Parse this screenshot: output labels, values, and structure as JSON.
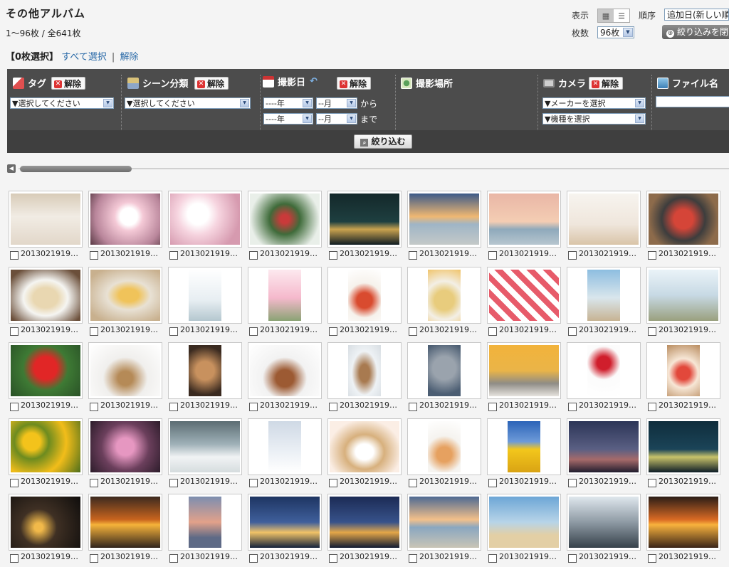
{
  "header": {
    "title": "その他アルバム",
    "count_text": "1〜96枚 / 全641枚",
    "selection_count": "【0枚選択】",
    "select_all": "すべて選択",
    "separator": "|",
    "deselect": "解除"
  },
  "controls": {
    "display_label": "表示",
    "view_grid_icon": "grid-view-icon",
    "view_list_icon": "list-view-icon",
    "order_label": "順序",
    "order_value": "追加日(新しい順",
    "count_label": "枚数",
    "count_value": "96枚",
    "narrow_button": "絞り込みを閉"
  },
  "filters": {
    "tag": {
      "label": "タグ",
      "clear": "解除",
      "select": "▼選択してください",
      "icon": "tag-icon",
      "color": "#e05050"
    },
    "scene": {
      "label": "シーン分類",
      "clear": "解除",
      "select": "▼選択してください",
      "icon": "scene-icon",
      "color": "#d9c27a"
    },
    "date": {
      "label": "撮影日",
      "clear": "解除",
      "icon": "calendar-icon",
      "reset_icon": "undo-icon",
      "year1": "----年",
      "month1": "--月",
      "from": "から",
      "year2": "----年",
      "month2": "--月",
      "to": "まで"
    },
    "place": {
      "label": "撮影場所",
      "icon": "map-icon"
    },
    "camera": {
      "label": "カメラ",
      "clear": "解除",
      "icon": "camera-icon",
      "maker": "▼メーカーを選択",
      "model": "▼機種を選択"
    },
    "filename": {
      "label": "ファイル名",
      "icon": "file-icon",
      "value": ""
    },
    "apply": "絞り込む"
  },
  "photo_label": "2013021919…",
  "photos": [
    [
      {
        "desc": "woman-cafe",
        "bg": "linear-gradient(#d8cbb8,#f1ece4 45%,#e2d7c9)",
        "p": false
      },
      {
        "desc": "cherry-blossom",
        "bg": "radial-gradient(circle at 55% 45%,#ffffff 0 18%,#f4c9d6 30%,#b9869b 70%,#5a3a45)",
        "p": false
      },
      {
        "desc": "cherry-blossom",
        "bg": "radial-gradient(circle at 40% 40%,#fff 0 20%,#f6d4df 40%,#d69aaf 80%)",
        "p": false
      },
      {
        "desc": "red-berries",
        "bg": "radial-gradient(circle at 50% 50%,#c93a3a 0 10%,#3f6b3a 35%,#e9efe9 80%)",
        "p": false
      },
      {
        "desc": "night-city",
        "bg": "linear-gradient(#14282a,#1e3f40 55%,#c9a24f 70%,#0f1c22)",
        "p": false
      },
      {
        "desc": "beach-sunset",
        "bg": "linear-gradient(#3c5a88,#f0b872 45%,#9fb5c6 60%,#c4c9c8)",
        "p": false
      },
      {
        "desc": "beach-dusk",
        "bg": "linear-gradient(#e9b6a6,#f4cdb3 55%,#8fa9bb 70%,#b7c6cf)",
        "p": false
      },
      {
        "desc": "woman-dog",
        "bg": "linear-gradient(#f7f4ef,#efe6dc 60%,#d9c4a8)",
        "p": false
      },
      {
        "desc": "sashimi",
        "bg": "radial-gradient(circle at 50% 50%,#d54538 0 22%,#3d3d3d 50%,#8d6b4b 80%)",
        "p": false
      }
    ],
    [
      {
        "desc": "food-plate",
        "bg": "radial-gradient(ellipse at 50% 55%,#e9d7b1 0 25%,#f5f5f2 45%,#6b4f3a 85%)",
        "p": false
      },
      {
        "desc": "tempura",
        "bg": "radial-gradient(ellipse at 55% 50%,#f0c35a 0 18%,#e8e1d4 40%,#c8b08e 85%)",
        "p": false
      },
      {
        "desc": "woman-camera",
        "bg": "linear-gradient(#ffffff,#e7eef2 60%,#b4c7cf)",
        "p": true
      },
      {
        "desc": "tulips",
        "bg": "linear-gradient(#fde9ef,#f5b9cc 55%,#8aa374)",
        "p": true
      },
      {
        "desc": "pasta",
        "bg": "radial-gradient(circle at 50% 60%,#d94b2f 0 22%,#f6f2ec 50%,#ffffff)",
        "p": true
      },
      {
        "desc": "spaghetti",
        "bg": "radial-gradient(circle at 50% 60%,#e8cc7d 0 28%,#f3efe6 55%,#f0c46a)",
        "p": true
      },
      {
        "desc": "salad-tray",
        "bg": "repeating-linear-gradient(45deg,#ffffff 0 8px,#e75b6a 8px 16px)",
        "p": false
      },
      {
        "desc": "beach-couple",
        "bg": "linear-gradient(#8dbde0,#d9e6ec 55%,#c7b393)",
        "p": true
      },
      {
        "desc": "elderly-couple",
        "bg": "linear-gradient(#eaf3f8,#c7d9e4 50%,#9aa07e)",
        "p": false
      }
    ],
    [
      {
        "desc": "hibiscus",
        "bg": "radial-gradient(circle at 50% 45%,#e12626 0 25%,#3e7a34 50%,#2a5227)",
        "p": false
      },
      {
        "desc": "dachshund",
        "bg": "radial-gradient(ellipse at 50% 65%,#b58a57 0 15%,#f0efed 45%,#ffffff)",
        "p": false
      },
      {
        "desc": "chihuahua",
        "bg": "radial-gradient(circle at 50% 50%,#c8915e 0 30%,#3a2a20 80%)",
        "p": true
      },
      {
        "desc": "poodle",
        "bg": "radial-gradient(ellipse at 50% 65%,#9c5a33 0 18%,#f2f2f2 45%,#ffffff)",
        "p": false
      },
      {
        "desc": "puppy",
        "bg": "radial-gradient(ellipse at 50% 55%,#a87a50 0 22%,#eef2f5 55%,#d7dde2)",
        "p": true
      },
      {
        "desc": "kitten",
        "bg": "radial-gradient(circle at 50% 45%,#9aa3ad 0 35%,#4c5e73 80%)",
        "p": true
      },
      {
        "desc": "cat-yellow",
        "bg": "linear-gradient(#f2b33b,#eab448 50%,#8f8c86 75%,#e6e3de)",
        "p": false
      },
      {
        "desc": "carnations",
        "bg": "radial-gradient(circle at 50% 35%,#d01e2c 0 18%,#fbfbfb 45%,#ffffff)",
        "p": true
      },
      {
        "desc": "cake",
        "bg": "radial-gradient(circle at 50% 55%,#e2483b 0 20%,#f7e7d6 45%,#b88b5e)",
        "p": true
      }
    ],
    [
      {
        "desc": "sunflowers",
        "bg": "radial-gradient(circle at 30% 40%,#f3c31b 0 15%,#6d8b1f 30%,#f2bd1a 60%,#4d6e1b)",
        "p": false
      },
      {
        "desc": "plum-blossom",
        "bg": "radial-gradient(circle at 50% 50%,#e697c1 0 20%,#6b3f5c 55%,#2c1c2a)",
        "p": false
      },
      {
        "desc": "snow-village",
        "bg": "linear-gradient(#5c6d73,#9fb1b8 45%,#f1f3f4 70%,#d5dcde)",
        "p": false
      },
      {
        "desc": "snow-cabin",
        "bg": "linear-gradient(#cfd9e5,#e9eef4 55%,#ffffff)",
        "p": true
      },
      {
        "desc": "japanese-meal",
        "bg": "radial-gradient(ellipse at 50% 60%,#ffffff 0 18%,#d7b07d 40%,#fbeee5 75%)",
        "p": false
      },
      {
        "desc": "bread-pasta",
        "bg": "radial-gradient(circle at 50% 65%,#e6a160 0 20%,#f5f3ef 50%,#ffffff)",
        "p": true
      },
      {
        "desc": "sunflower-field",
        "bg": "linear-gradient(#2c64b8,#6d9ad8 40%,#f3c71c 55%,#d9a314)",
        "p": true
      },
      {
        "desc": "city-dusk",
        "bg": "linear-gradient(#2c3557,#5a5f83 55%,#a66a6a 75%,#201d2e)",
        "p": false
      },
      {
        "desc": "harbor-night",
        "bg": "linear-gradient(#0f2d3c,#1b4458 55%,#c9c36a 70%,#0d1c26)",
        "p": false
      }
    ],
    [
      {
        "desc": "city-aerial-night",
        "bg": "radial-gradient(circle at 40% 60%,#f1b94a 0 8%,#3f3024 35%,#0f0d0c)",
        "p": false
      },
      {
        "desc": "sunset-sea",
        "bg": "linear-gradient(#3c2a1f,#c8641e 45%,#f6b33a 55%,#31241d)",
        "p": false
      },
      {
        "desc": "sunset-clouds",
        "bg": "linear-gradient(#7d8eb0,#e2a18a 50%,#5e6a86 80%)",
        "p": true
      },
      {
        "desc": "paris-night",
        "bg": "linear-gradient(#1e3562,#3f5f9b 50%,#f0c267 70%,#13223d)",
        "p": false
      },
      {
        "desc": "city-lights",
        "bg": "linear-gradient(#1c2b55,#37528a 50%,#e3a648 70%,#111a33)",
        "p": false
      },
      {
        "desc": "beach-sunset",
        "bg": "linear-gradient(#4e6a93,#f3c08a 45%,#8aa7c0 60%,#c9c4b6)",
        "p": false
      },
      {
        "desc": "palm-beach",
        "bg": "linear-gradient(#6da6d6,#b7d4e8 50%,#e3cfa5 75%)",
        "p": false
      },
      {
        "desc": "group-celebration",
        "bg": "linear-gradient(#dfe7ed,#8e9aa4 50%,#36414a)",
        "p": false
      },
      {
        "desc": "sunset-ocean",
        "bg": "linear-gradient(#2a1d16,#d96a24 45%,#f8b23d 55%,#3a2418)",
        "p": false
      }
    ]
  ]
}
